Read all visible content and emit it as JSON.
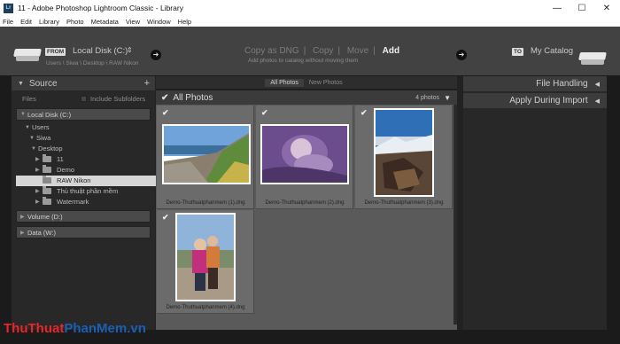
{
  "window": {
    "title": "11 - Adobe Photoshop Lightroom Classic - Library",
    "logo": "Lr",
    "minimize_icon": "minimize-icon",
    "maximize_icon": "maximize-icon",
    "close_icon": "close-icon"
  },
  "menu": [
    "File",
    "Edit",
    "Library",
    "Photo",
    "Metadata",
    "View",
    "Window",
    "Help"
  ],
  "header": {
    "from_tag": "FROM",
    "from_source": "Local Disk (C:)",
    "from_path": "Users \\ Siwa \\ Desktop \\ RAW Nikon",
    "modes": [
      "Copy as DNG",
      "Copy",
      "Move",
      "Add"
    ],
    "active_mode": "Add",
    "mode_description": "Add photos to catalog without moving them",
    "to_tag": "TO",
    "to_target": "My Catalog"
  },
  "source": {
    "title": "Source",
    "add_symbol": "+",
    "files_label": "Files",
    "include_subfolders": "Include Subfolders",
    "volumes": [
      "Local Disk (C:)",
      "Volume (D:)",
      "Data (W:)"
    ],
    "tree": [
      {
        "label": "Users"
      },
      {
        "label": "Siwa"
      },
      {
        "label": "Desktop"
      },
      {
        "label": "11"
      },
      {
        "label": "Demo"
      },
      {
        "label": "RAW Nikon"
      },
      {
        "label": "Thủ thuật phần mềm"
      },
      {
        "label": "Watermark"
      }
    ]
  },
  "center": {
    "tabs": [
      "All Photos",
      "New Photos"
    ],
    "active_tab": "All Photos",
    "grid_title": "All Photos",
    "count": "4 photos",
    "photos": [
      {
        "name": "Demo-Thuthuatphanmem (1).dng",
        "checked": true
      },
      {
        "name": "Demo-Thuthuatphanmem (2).dng",
        "checked": true
      },
      {
        "name": "Demo-Thuthuatphanmem (3).dng",
        "checked": true
      },
      {
        "name": "Demo-Thuthuatphanmem (4).dng",
        "checked": true
      }
    ]
  },
  "right": {
    "panels": [
      "File Handling",
      "Apply During Import"
    ]
  },
  "watermark": {
    "part1": "Thu",
    "part2": "Thuat",
    "part3": "PhanMem",
    ".vn": ".vn"
  },
  "colors": {
    "watermark_red": "#e8262a",
    "watermark_blue": "#1a5fb4"
  }
}
